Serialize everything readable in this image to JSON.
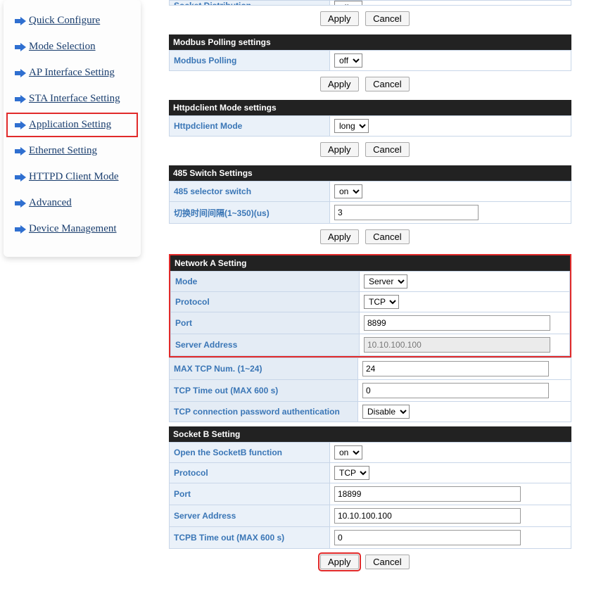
{
  "sidebar": {
    "items": [
      {
        "label": "Quick Configure"
      },
      {
        "label": "Mode Selection"
      },
      {
        "label": "AP Interface Setting"
      },
      {
        "label": "STA Interface Setting"
      },
      {
        "label": "Application Setting"
      },
      {
        "label": "Ethernet Setting"
      },
      {
        "label": "HTTPD Client Mode"
      },
      {
        "label": "Advanced"
      },
      {
        "label": "Device Management"
      }
    ]
  },
  "socket_dist": {
    "label": "Socket Distribution",
    "value": "off"
  },
  "button_labels": {
    "apply": "Apply",
    "cancel": "Cancel"
  },
  "modbus": {
    "header": "Modbus Polling settings",
    "label": "Modbus Polling",
    "value": "off"
  },
  "httpd": {
    "header": "Httpdclient Mode settings",
    "label": "Httpdclient Mode",
    "value": "long"
  },
  "switch485": {
    "header": "485 Switch Settings",
    "selector_label": "485 selector switch",
    "selector_value": "on",
    "interval_label": "切换时间间隔(1~350)(us)",
    "interval_value": "3"
  },
  "networkA": {
    "header": "Network A Setting",
    "mode_label": "Mode",
    "mode_value": "Server",
    "protocol_label": "Protocol",
    "protocol_value": "TCP",
    "port_label": "Port",
    "port_value": "8899",
    "server_addr_label": "Server Address",
    "server_addr_value": "10.10.100.100",
    "maxtcp_label": "MAX TCP Num. (1~24)",
    "maxtcp_value": "24",
    "timeout_label": "TCP Time out (MAX 600 s)",
    "timeout_value": "0",
    "auth_label": "TCP connection password authentication",
    "auth_value": "Disable"
  },
  "socketB": {
    "header": "Socket B Setting",
    "open_label": "Open the SocketB function",
    "open_value": "on",
    "protocol_label": "Protocol",
    "protocol_value": "TCP",
    "port_label": "Port",
    "port_value": "18899",
    "server_addr_label": "Server Address",
    "server_addr_value": "10.10.100.100",
    "timeout_label": "TCPB Time out (MAX 600 s)",
    "timeout_value": "0"
  }
}
